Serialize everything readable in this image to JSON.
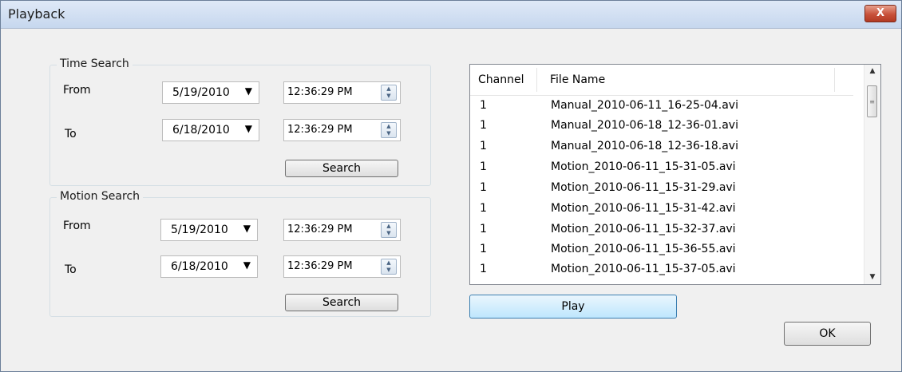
{
  "window": {
    "title": "Playback",
    "close_glyph": "X"
  },
  "time_search": {
    "title": "Time Search",
    "from_label": "From",
    "to_label": "To",
    "from_date": "5/19/2010",
    "from_time": "12:36:29 PM",
    "to_date": "6/18/2010",
    "to_time": "12:36:29 PM",
    "search_label": "Search"
  },
  "motion_search": {
    "title": "Motion Search",
    "from_label": "From",
    "to_label": "To",
    "from_date": "5/19/2010",
    "from_time": "12:36:29 PM",
    "to_date": "6/18/2010",
    "to_time": "12:36:29 PM",
    "search_label": "Search"
  },
  "file_list": {
    "columns": [
      "Channel",
      "File Name"
    ],
    "rows": [
      {
        "channel": "1",
        "file": "Manual_2010-06-11_16-25-04.avi"
      },
      {
        "channel": "1",
        "file": "Manual_2010-06-18_12-36-01.avi"
      },
      {
        "channel": "1",
        "file": "Manual_2010-06-18_12-36-18.avi"
      },
      {
        "channel": "1",
        "file": "Motion_2010-06-11_15-31-05.avi"
      },
      {
        "channel": "1",
        "file": "Motion_2010-06-11_15-31-29.avi"
      },
      {
        "channel": "1",
        "file": "Motion_2010-06-11_15-31-42.avi"
      },
      {
        "channel": "1",
        "file": "Motion_2010-06-11_15-32-37.avi"
      },
      {
        "channel": "1",
        "file": "Motion_2010-06-11_15-36-55.avi"
      },
      {
        "channel": "1",
        "file": "Motion_2010-06-11_15-37-05.avi"
      }
    ]
  },
  "buttons": {
    "play": "Play",
    "ok": "OK"
  },
  "colors": {
    "close_button": "#c8513a",
    "play_border": "#3c7fb1",
    "title_bar": "#c6d7ee"
  }
}
